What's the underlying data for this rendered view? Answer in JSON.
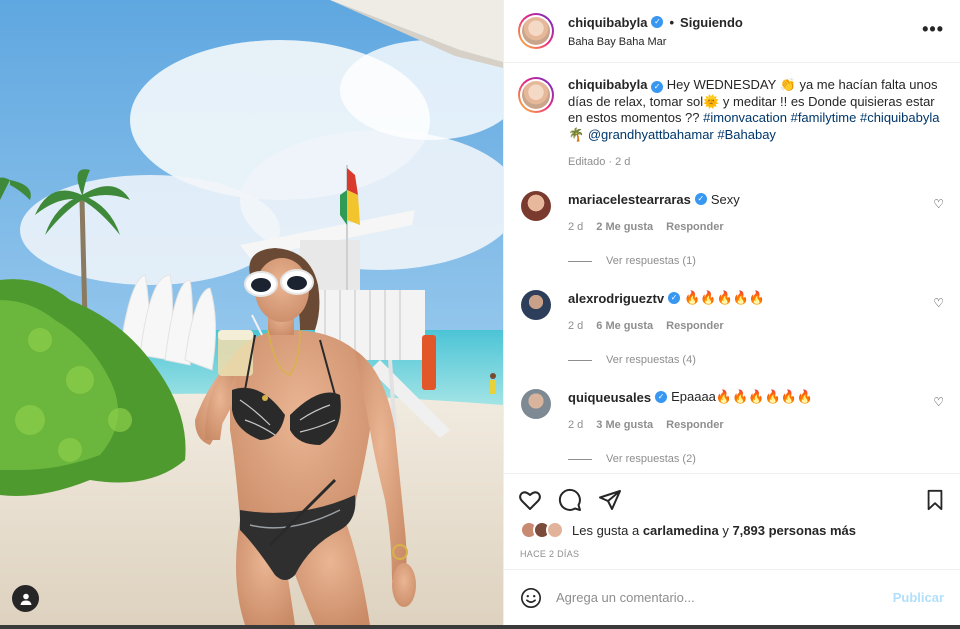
{
  "post": {
    "author": "chiquibabyla",
    "separator": "•",
    "following_label": "Siguiendo",
    "location": "Baha Bay Baha Mar",
    "more_icon": "more-horizontal-icon"
  },
  "caption": {
    "author": "chiquibabyla",
    "text_1": "Hey WEDNESDAY 👏 ya me hacían falta unos días de relax, tomar sol🌞 y meditar !! es Donde quisieras estar en estos momentos ?? ",
    "tag_1": "#imonvacation",
    "tag_2": "#familytime",
    "tag_3": "#chiquibabyla",
    "palm": "🌴 ",
    "tag_4": "@grandhyattbahamar",
    "tag_5": "#Bahabay",
    "edited": "Editado · 2 d"
  },
  "comments": [
    {
      "user": "mariacelestearraras",
      "text": "Sexy",
      "time": "2 d",
      "likes": "2 Me gusta",
      "reply": "Responder",
      "replies": "Ver respuestas (1)",
      "avatar_color": "#7a3b2e"
    },
    {
      "user": "alexrodrigueztv",
      "text": "🔥🔥🔥🔥🔥",
      "time": "2 d",
      "likes": "6 Me gusta",
      "reply": "Responder",
      "replies": "Ver respuestas (4)",
      "avatar_color": "#2d3e5a"
    },
    {
      "user": "quiqueusales",
      "text": "Epaaaa🔥🔥🔥🔥🔥🔥",
      "time": "2 d",
      "likes": "3 Me gusta",
      "reply": "Responder",
      "replies": "Ver respuestas (2)",
      "avatar_color": "#7d8a94"
    }
  ],
  "likes": {
    "prefix": "Les gusta a ",
    "user": "carlamedina",
    "middle": " y ",
    "count": "7,893 personas más"
  },
  "time_ago": "HACE 2 DÍAS",
  "composer": {
    "placeholder": "Agrega un comentario...",
    "publish": "Publicar"
  },
  "colors": {
    "link": "#00376b",
    "verified": "#3897f0",
    "muted": "#8e8e8e"
  }
}
